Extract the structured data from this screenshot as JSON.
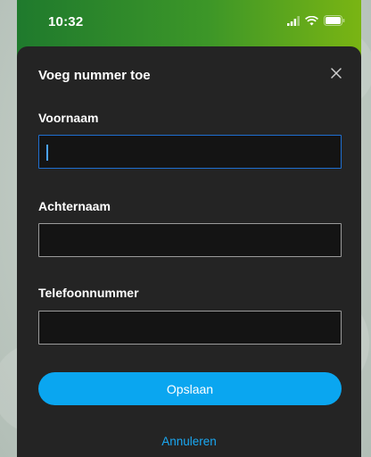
{
  "status_bar": {
    "time": "10:32",
    "icons": [
      "signal-icon",
      "wifi-icon",
      "battery-icon"
    ]
  },
  "sheet": {
    "title": "Voeg nummer toe",
    "close_icon": "close-icon"
  },
  "form": {
    "first_name": {
      "label": "Voornaam",
      "value": ""
    },
    "last_name": {
      "label": "Achternaam",
      "value": ""
    },
    "phone": {
      "label": "Telefoonnummer",
      "value": ""
    }
  },
  "actions": {
    "save_label": "Opslaan",
    "cancel_label": "Annuleren"
  },
  "colors": {
    "sheet_bg": "#242424",
    "input_bg": "#141414",
    "focus_border": "#1f6fd1",
    "primary_button": "#0aa6f0",
    "link": "#1aa8f2",
    "header_gradient_start": "#1f7a2d",
    "header_gradient_end": "#7ab513"
  }
}
